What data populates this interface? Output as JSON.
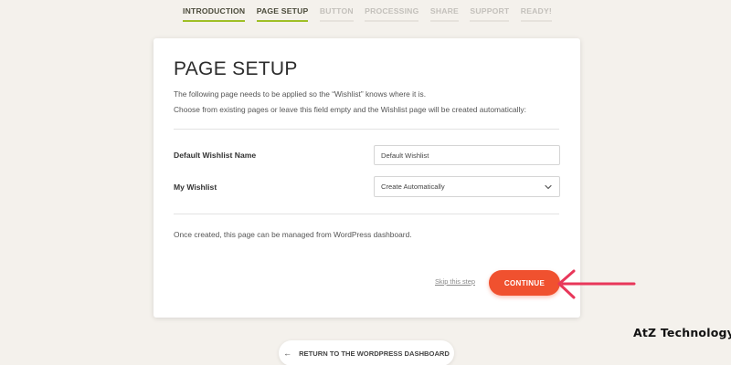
{
  "steps": [
    {
      "label": "INTRODUCTION",
      "state": "done"
    },
    {
      "label": "PAGE SETUP",
      "state": "active"
    },
    {
      "label": "BUTTON",
      "state": "pending"
    },
    {
      "label": "PROCESSING",
      "state": "pending"
    },
    {
      "label": "SHARE",
      "state": "pending"
    },
    {
      "label": "SUPPORT",
      "state": "pending"
    },
    {
      "label": "READY!",
      "state": "pending"
    }
  ],
  "card": {
    "title": "PAGE SETUP",
    "description_1": "The following page needs to be applied so the “Wishlist” knows where it is.",
    "description_2": "Choose from existing pages or leave this field empty and the Wishlist page will be created automatically:",
    "fields": {
      "wishlist_name": {
        "label": "Default Wishlist Name",
        "value": "Default Wishlist"
      },
      "my_wishlist": {
        "label": "My Wishlist",
        "selected": "Create Automatically"
      }
    },
    "note": "Once created, this page can be managed from WordPress dashboard.",
    "skip_label": "Skip this step",
    "continue_label": "CONTINUE"
  },
  "return_button": {
    "label": "RETURN TO THE WORDPRESS DASHBOARD",
    "icon": "arrow-left-icon"
  },
  "watermark": "AtZ Technology",
  "colors": {
    "background": "#f4f1ec",
    "accent_green": "#9fbf26",
    "continue_orange": "#f0512f",
    "annotation_arrow": "#e8375a"
  }
}
